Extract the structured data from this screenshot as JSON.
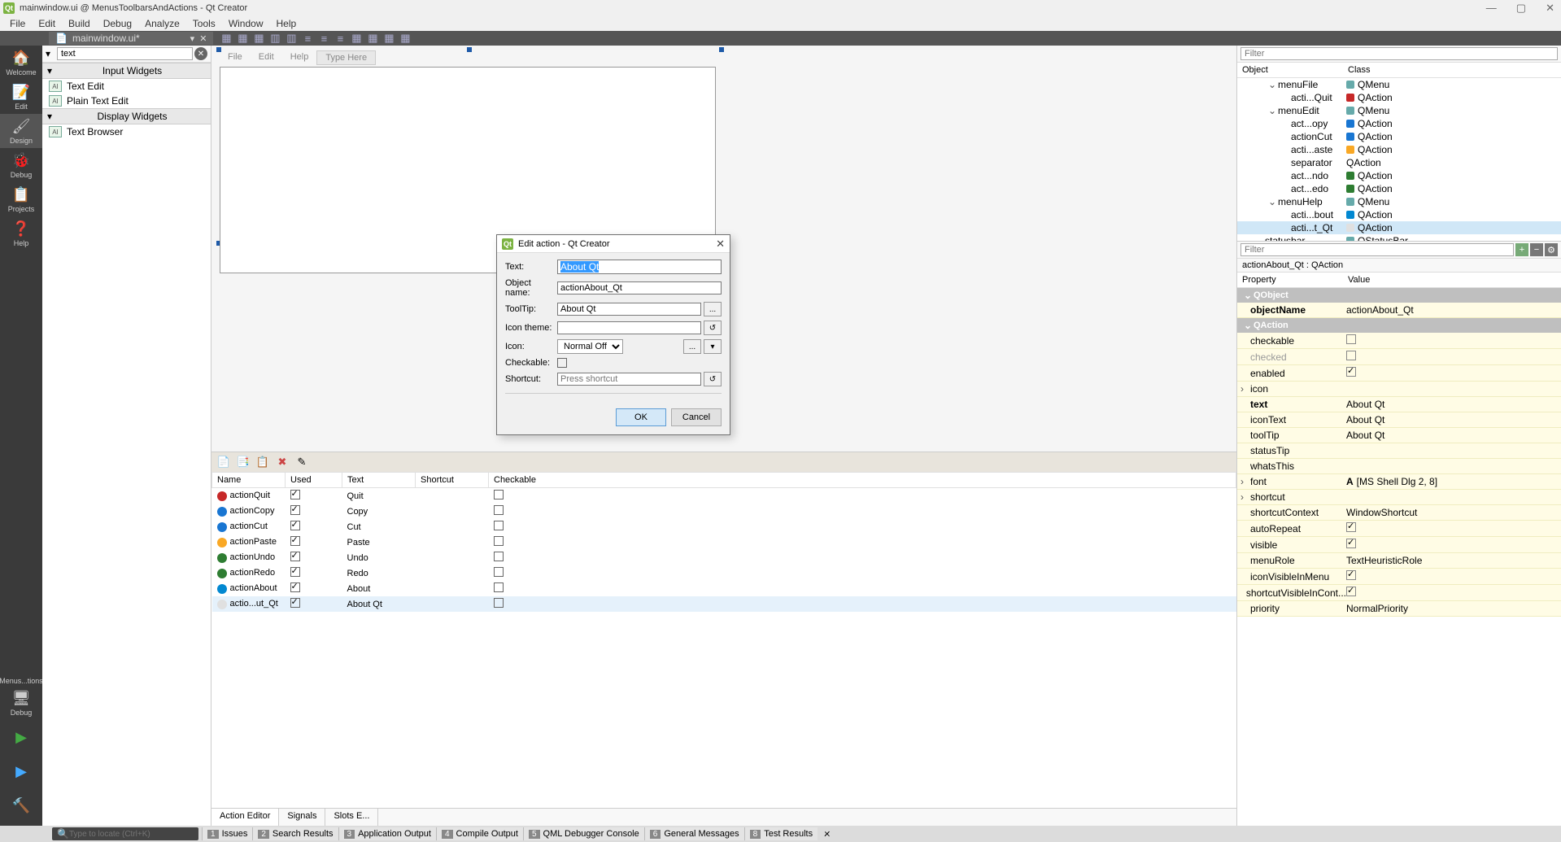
{
  "title": "mainwindow.ui @ MenusToolbarsAndActions - Qt Creator",
  "menubar": [
    "File",
    "Edit",
    "Build",
    "Debug",
    "Analyze",
    "Tools",
    "Window",
    "Help"
  ],
  "doctab": {
    "name": "mainwindow.ui*"
  },
  "leftnav": {
    "items": [
      {
        "label": "Welcome"
      },
      {
        "label": "Edit"
      },
      {
        "label": "Design"
      },
      {
        "label": "Debug"
      },
      {
        "label": "Projects"
      },
      {
        "label": "Help"
      }
    ],
    "active": 2,
    "bottom": {
      "project": "Menus...tions",
      "config": "Debug"
    }
  },
  "widgetbox": {
    "filter_value": "text",
    "categories": [
      {
        "name": "Input Widgets",
        "items": [
          "Text Edit",
          "Plain Text Edit"
        ]
      },
      {
        "name": "Display Widgets",
        "items": [
          "Text Browser"
        ]
      }
    ]
  },
  "formmenus": [
    "File",
    "Edit",
    "Help"
  ],
  "type_here": "Type Here",
  "action_editor": {
    "columns": [
      "Name",
      "Used",
      "Text",
      "Shortcut",
      "Checkable"
    ],
    "rows": [
      {
        "icon": "#c62828",
        "name": "actionQuit",
        "used": true,
        "text": "Quit",
        "shortcut": "",
        "checkable": false
      },
      {
        "icon": "#1976d2",
        "name": "actionCopy",
        "used": true,
        "text": "Copy",
        "shortcut": "",
        "checkable": false
      },
      {
        "icon": "#1976d2",
        "name": "actionCut",
        "used": true,
        "text": "Cut",
        "shortcut": "",
        "checkable": false
      },
      {
        "icon": "#f9a825",
        "name": "actionPaste",
        "used": true,
        "text": "Paste",
        "shortcut": "",
        "checkable": false
      },
      {
        "icon": "#2e7d32",
        "name": "actionUndo",
        "used": true,
        "text": "Undo",
        "shortcut": "",
        "checkable": false
      },
      {
        "icon": "#2e7d32",
        "name": "actionRedo",
        "used": true,
        "text": "Redo",
        "shortcut": "",
        "checkable": false
      },
      {
        "icon": "#0288d1",
        "name": "actionAbout",
        "used": true,
        "text": "About",
        "shortcut": "",
        "checkable": false
      },
      {
        "icon": "#e0e0e0",
        "name": "actio...ut_Qt",
        "used": true,
        "text": "About Qt",
        "shortcut": "",
        "checkable": false
      }
    ],
    "selected": 7,
    "tabs": [
      "Action Editor",
      "Signals",
      "Slots E..."
    ],
    "active_tab": 0
  },
  "object_inspector": {
    "filter_placeholder": "Filter",
    "columns": [
      "Object",
      "Class"
    ],
    "rows": [
      {
        "depth": 1,
        "exp": "v",
        "obj": "menuFile",
        "cls": "QMenu",
        "icon": "#6aa"
      },
      {
        "depth": 2,
        "exp": "",
        "obj": "acti...Quit",
        "cls": "QAction",
        "icon": "#c62828"
      },
      {
        "depth": 1,
        "exp": "v",
        "obj": "menuEdit",
        "cls": "QMenu",
        "icon": "#6aa"
      },
      {
        "depth": 2,
        "exp": "",
        "obj": "act...opy",
        "cls": "QAction",
        "icon": "#1976d2"
      },
      {
        "depth": 2,
        "exp": "",
        "obj": "actionCut",
        "cls": "QAction",
        "icon": "#1976d2"
      },
      {
        "depth": 2,
        "exp": "",
        "obj": "acti...aste",
        "cls": "QAction",
        "icon": "#f9a825"
      },
      {
        "depth": 2,
        "exp": "",
        "obj": "separator",
        "cls": "QAction",
        "icon": ""
      },
      {
        "depth": 2,
        "exp": "",
        "obj": "act...ndo",
        "cls": "QAction",
        "icon": "#2e7d32"
      },
      {
        "depth": 2,
        "exp": "",
        "obj": "act...edo",
        "cls": "QAction",
        "icon": "#2e7d32"
      },
      {
        "depth": 1,
        "exp": "v",
        "obj": "menuHelp",
        "cls": "QMenu",
        "icon": "#6aa"
      },
      {
        "depth": 2,
        "exp": "",
        "obj": "acti...bout",
        "cls": "QAction",
        "icon": "#0288d1"
      },
      {
        "depth": 2,
        "exp": "",
        "obj": "acti...t_Qt",
        "cls": "QAction",
        "icon": "#e0e0e0",
        "sel": true
      },
      {
        "depth": 0,
        "exp": "",
        "obj": "statusbar",
        "cls": "QStatusBar",
        "icon": "#6aa"
      }
    ]
  },
  "property_editor": {
    "filter_placeholder": "Filter",
    "path": "actionAbout_Qt : QAction",
    "columns": [
      "Property",
      "Value"
    ],
    "groups": [
      {
        "name": "QObject",
        "rows": [
          {
            "name": "objectName",
            "val": "actionAbout_Qt",
            "bold": true
          }
        ]
      },
      {
        "name": "QAction",
        "rows": [
          {
            "name": "checkable",
            "type": "check",
            "checked": false
          },
          {
            "name": "checked",
            "type": "check",
            "checked": false,
            "disabled": true
          },
          {
            "name": "enabled",
            "type": "check",
            "checked": true
          },
          {
            "name": "icon",
            "type": "expand",
            "val": ""
          },
          {
            "name": "text",
            "val": "About Qt",
            "bold": true
          },
          {
            "name": "iconText",
            "val": "About Qt"
          },
          {
            "name": "toolTip",
            "val": "About Qt"
          },
          {
            "name": "statusTip",
            "val": ""
          },
          {
            "name": "whatsThis",
            "val": ""
          },
          {
            "name": "font",
            "val": "[MS Shell Dlg 2, 8]",
            "type": "expand",
            "icon": "A"
          },
          {
            "name": "shortcut",
            "type": "expand",
            "val": ""
          },
          {
            "name": "shortcutContext",
            "val": "WindowShortcut"
          },
          {
            "name": "autoRepeat",
            "type": "check",
            "checked": true
          },
          {
            "name": "visible",
            "type": "check",
            "checked": true
          },
          {
            "name": "menuRole",
            "val": "TextHeuristicRole"
          },
          {
            "name": "iconVisibleInMenu",
            "type": "check",
            "checked": true
          },
          {
            "name": "shortcutVisibleInCont...",
            "type": "check",
            "checked": true
          },
          {
            "name": "priority",
            "val": "NormalPriority"
          }
        ]
      }
    ]
  },
  "dialog": {
    "title": "Edit action - Qt Creator",
    "text_label": "Text:",
    "text_value": "About Qt",
    "objname_label": "Object name:",
    "objname_value": "actionAbout_Qt",
    "tooltip_label": "ToolTip:",
    "tooltip_value": "About Qt",
    "icontheme_label": "Icon theme:",
    "icon_label": "Icon:",
    "icon_value": "Normal Off",
    "checkable_label": "Checkable:",
    "shortcut_label": "Shortcut:",
    "shortcut_placeholder": "Press shortcut",
    "ok": "OK",
    "cancel": "Cancel",
    "ellipsis": "..."
  },
  "statusbar": {
    "search_placeholder": "Type to locate (Ctrl+K)",
    "tabs": [
      {
        "n": "1",
        "t": "Issues"
      },
      {
        "n": "2",
        "t": "Search Results"
      },
      {
        "n": "3",
        "t": "Application Output"
      },
      {
        "n": "4",
        "t": "Compile Output"
      },
      {
        "n": "5",
        "t": "QML Debugger Console"
      },
      {
        "n": "6",
        "t": "General Messages"
      },
      {
        "n": "8",
        "t": "Test Results"
      }
    ]
  }
}
